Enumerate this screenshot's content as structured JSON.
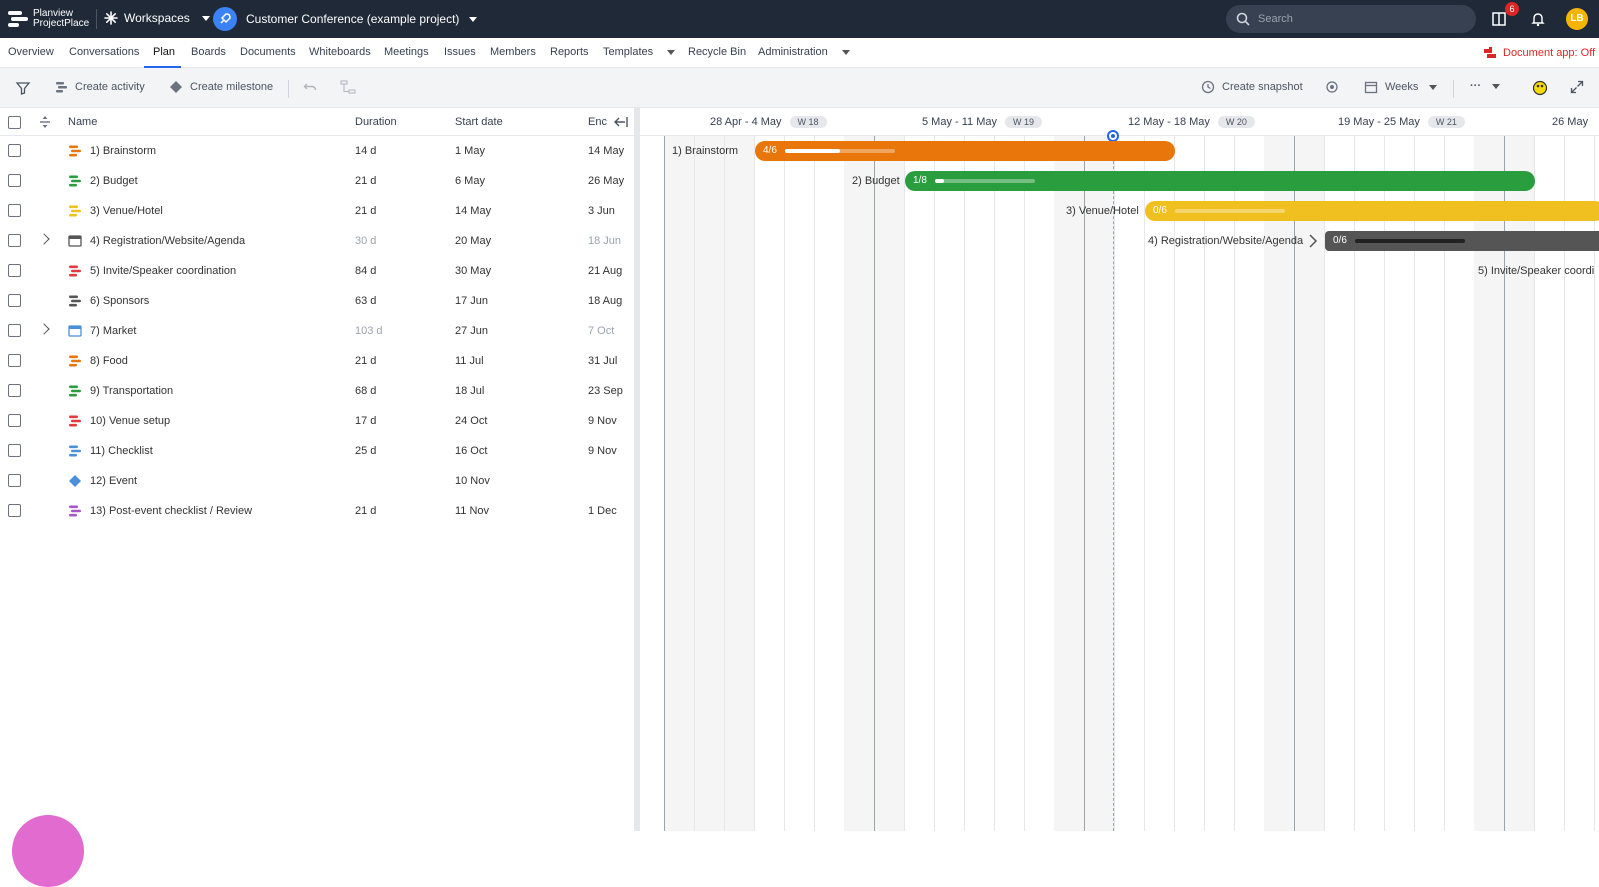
{
  "topbar": {
    "brand_line1": "Planview",
    "brand_line2": "ProjectPlace",
    "workspaces_label": "Workspaces",
    "project_name": "Customer Conference (example project)",
    "search_placeholder": "Search",
    "notification_count": "6",
    "user_initials": "LB"
  },
  "nav": {
    "items": [
      "Overview",
      "Conversations",
      "Plan",
      "Boards",
      "Documents",
      "Whiteboards",
      "Meetings",
      "Issues",
      "Members",
      "Reports",
      "Templates",
      "Recycle Bin",
      "Administration"
    ],
    "active": "Plan",
    "document_app_status": "Document app: Off"
  },
  "toolbar": {
    "create_activity": "Create activity",
    "create_milestone": "Create milestone",
    "create_snapshot": "Create snapshot",
    "timescale": "Weeks",
    "more": "···"
  },
  "grid": {
    "columns": {
      "name": "Name",
      "duration": "Duration",
      "start": "Start date",
      "end": "Enc"
    },
    "rows": [
      {
        "name": "1) Brainstorm",
        "duration": "14 d",
        "start": "1 May",
        "end": "14 May",
        "color": "#e8760a",
        "dim": false,
        "expandable": false,
        "type": "activity"
      },
      {
        "name": "2) Budget",
        "duration": "21 d",
        "start": "6 May",
        "end": "26 May",
        "color": "#2a9d3f",
        "dim": false,
        "expandable": false,
        "type": "activity"
      },
      {
        "name": "3) Venue/Hotel",
        "duration": "21 d",
        "start": "14 May",
        "end": "3 Jun",
        "color": "#f0c020",
        "dim": false,
        "expandable": false,
        "type": "activity"
      },
      {
        "name": "4) Registration/Website/Agenda",
        "duration": "30 d",
        "start": "20 May",
        "end": "18 Jun",
        "color": "#555555",
        "dim": true,
        "expandable": true,
        "type": "group"
      },
      {
        "name": "5) Invite/Speaker coordination",
        "duration": "84 d",
        "start": "30 May",
        "end": "21 Aug",
        "color": "#e03c3c",
        "dim": false,
        "expandable": false,
        "type": "activity"
      },
      {
        "name": "6) Sponsors",
        "duration": "63 d",
        "start": "17 Jun",
        "end": "18 Aug",
        "color": "#555555",
        "dim": false,
        "expandable": false,
        "type": "activity"
      },
      {
        "name": "7) Market",
        "duration": "103 d",
        "start": "27 Jun",
        "end": "7 Oct",
        "color": "#4a90d9",
        "dim": true,
        "expandable": true,
        "type": "group"
      },
      {
        "name": "8) Food",
        "duration": "21 d",
        "start": "11 Jul",
        "end": "31 Jul",
        "color": "#e8760a",
        "dim": false,
        "expandable": false,
        "type": "activity"
      },
      {
        "name": "9) Transportation",
        "duration": "68 d",
        "start": "18 Jul",
        "end": "23 Sep",
        "color": "#2a9d3f",
        "dim": false,
        "expandable": false,
        "type": "activity"
      },
      {
        "name": "10) Venue setup",
        "duration": "17 d",
        "start": "24 Oct",
        "end": "9 Nov",
        "color": "#e03c3c",
        "dim": false,
        "expandable": false,
        "type": "activity"
      },
      {
        "name": "11) Checklist",
        "duration": "25 d",
        "start": "16 Oct",
        "end": "9 Nov",
        "color": "#4a90d9",
        "dim": false,
        "expandable": false,
        "type": "activity"
      },
      {
        "name": "12) Event",
        "duration": "",
        "start": "10 Nov",
        "end": "",
        "color": "#4a90d9",
        "dim": false,
        "expandable": false,
        "type": "milestone"
      },
      {
        "name": "13) Post-event checklist / Review",
        "duration": "21 d",
        "start": "11 Nov",
        "end": "1 Dec",
        "color": "#a855c8",
        "dim": false,
        "expandable": false,
        "type": "activity"
      }
    ]
  },
  "gantt": {
    "weeks": [
      {
        "range": "28 Apr - 4 May",
        "week": "W 18"
      },
      {
        "range": "5 May - 11 May",
        "week": "W 19"
      },
      {
        "range": "12 May - 18 May",
        "week": "W 20"
      },
      {
        "range": "19 May - 25 May",
        "week": "W 21"
      },
      {
        "range": "26 May",
        "week": ""
      }
    ],
    "bars": [
      {
        "label": "1) Brainstorm",
        "progress": "4/6",
        "done_fraction": 0.67,
        "color": "#e8760a"
      },
      {
        "label": "2) Budget",
        "progress": "1/8",
        "done_fraction": 0.125,
        "color": "#2a9d3f"
      },
      {
        "label": "3) Venue/Hotel",
        "progress": "0/6",
        "done_fraction": 0.0,
        "color": "#f0c020"
      },
      {
        "label": "4) Registration/Website/Agenda",
        "progress": "0/6",
        "done_fraction": 0.0,
        "color": "#555555"
      },
      {
        "label": "5) Invite/Speaker coordi",
        "progress": "",
        "done_fraction": 0.0,
        "color": "#e03c3c"
      }
    ]
  }
}
